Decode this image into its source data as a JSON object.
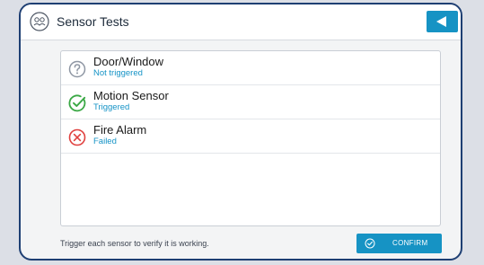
{
  "header": {
    "title": "Sensor Tests",
    "icon": "sensor-group-icon",
    "back_icon": "back-arrow-icon"
  },
  "sensors": [
    {
      "name": "Door/Window",
      "status": "Not triggered",
      "icon": "question-circle-icon",
      "icon_color": "#8e96a3"
    },
    {
      "name": "Motion Sensor",
      "status": "Triggered",
      "icon": "check-circle-icon",
      "icon_color": "#3aa845"
    },
    {
      "name": "Fire Alarm",
      "status": "Failed",
      "icon": "x-circle-icon",
      "icon_color": "#e0413f"
    }
  ],
  "footer": {
    "hint": "Trigger each sensor to verify it is working.",
    "confirm_label": "CONFIRM",
    "confirm_icon": "check-circle-icon"
  },
  "colors": {
    "accent": "#1693c4",
    "frame": "#1e3f73",
    "status_text": "#1593c6"
  }
}
